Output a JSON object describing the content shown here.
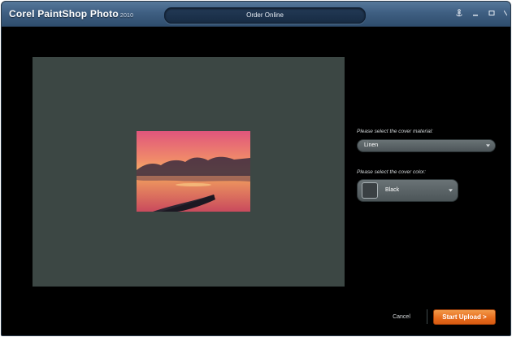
{
  "titlebar": {
    "app_name": "Corel PaintShop Photo",
    "app_year": "2010",
    "tab_label": "Order Online"
  },
  "icons": {
    "help": "anchor-help-icon",
    "minimize": "minimize-icon",
    "maximize": "maximize-icon",
    "close": "close-icon"
  },
  "cover_material": {
    "prompt": "Please select the cover material:",
    "selected": "Linen"
  },
  "cover_color": {
    "prompt": "Please select the cover color:",
    "selected": "Black",
    "swatch": "#3a4043"
  },
  "actions": {
    "cancel_label": "Cancel",
    "upload_label": "Start Upload >"
  },
  "colors": {
    "accent": "#e8731f",
    "panel": "#3c4744",
    "titlebar": "#3f5f82"
  }
}
